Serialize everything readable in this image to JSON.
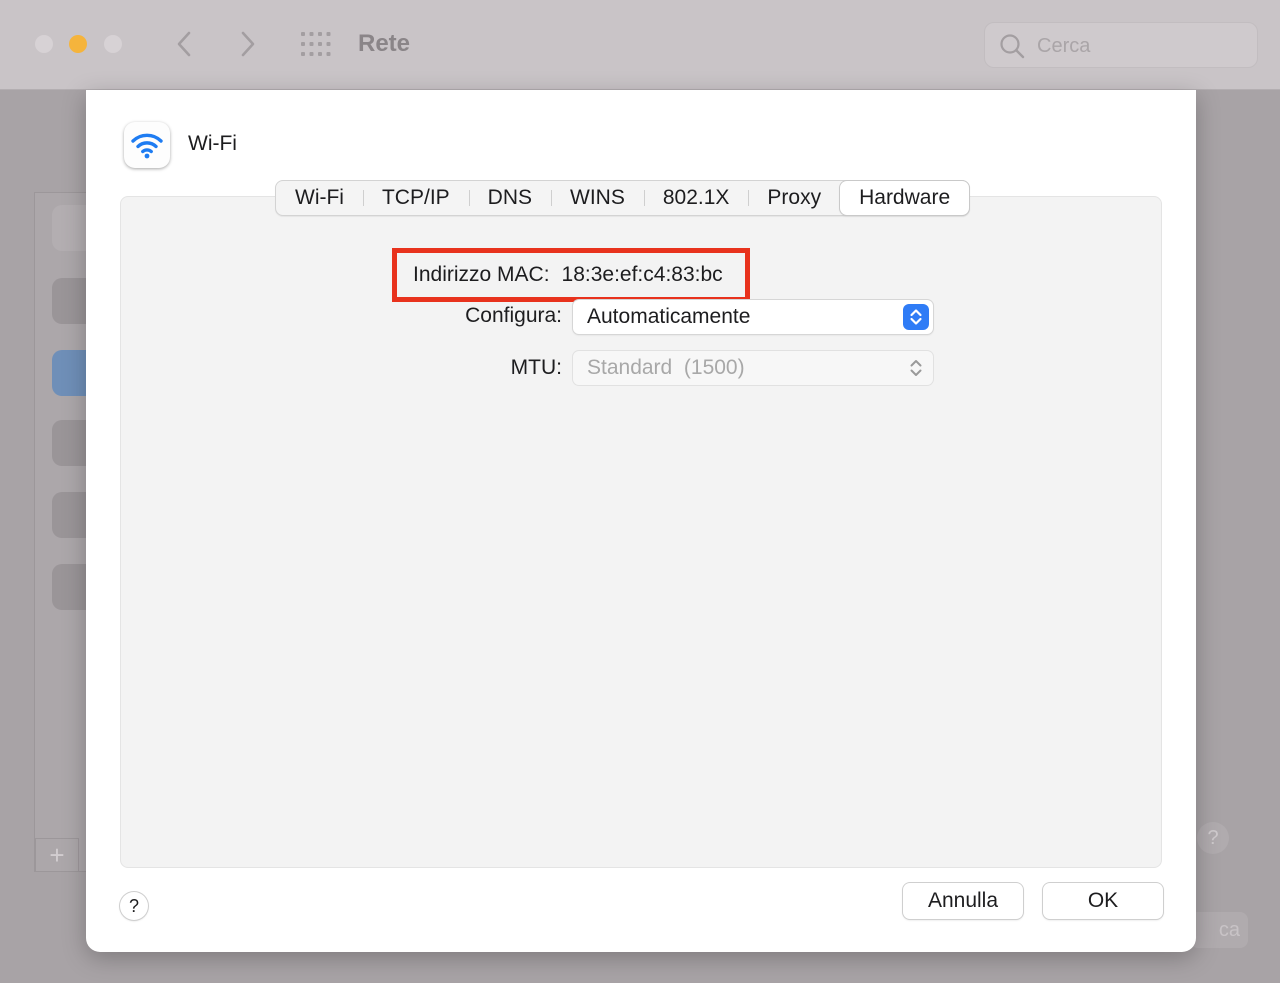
{
  "window": {
    "title": "Rete",
    "search_placeholder": "Cerca"
  },
  "background": {
    "add_label": "+",
    "help_label": "?",
    "partial_button_label": "ca"
  },
  "sheet": {
    "service_name": "Wi-Fi",
    "tabs": [
      {
        "label": "Wi-Fi",
        "active": false
      },
      {
        "label": "TCP/IP",
        "active": false
      },
      {
        "label": "DNS",
        "active": false
      },
      {
        "label": "WINS",
        "active": false
      },
      {
        "label": "802.1X",
        "active": false
      },
      {
        "label": "Proxy",
        "active": false
      },
      {
        "label": "Hardware",
        "active": true
      }
    ],
    "mac": {
      "label": "Indirizzo MAC:",
      "value": "18:3e:ef:c4:83:bc"
    },
    "configure": {
      "label": "Configura:",
      "value": "Automaticamente"
    },
    "mtu": {
      "label": "MTU:",
      "value": "Standard  (1500)"
    },
    "help_label": "?",
    "cancel_label": "Annulla",
    "ok_label": "OK"
  },
  "colors": {
    "accent": "#2f7cf6",
    "highlight_box": "#e8321d",
    "minimize": "#f5b43c"
  }
}
